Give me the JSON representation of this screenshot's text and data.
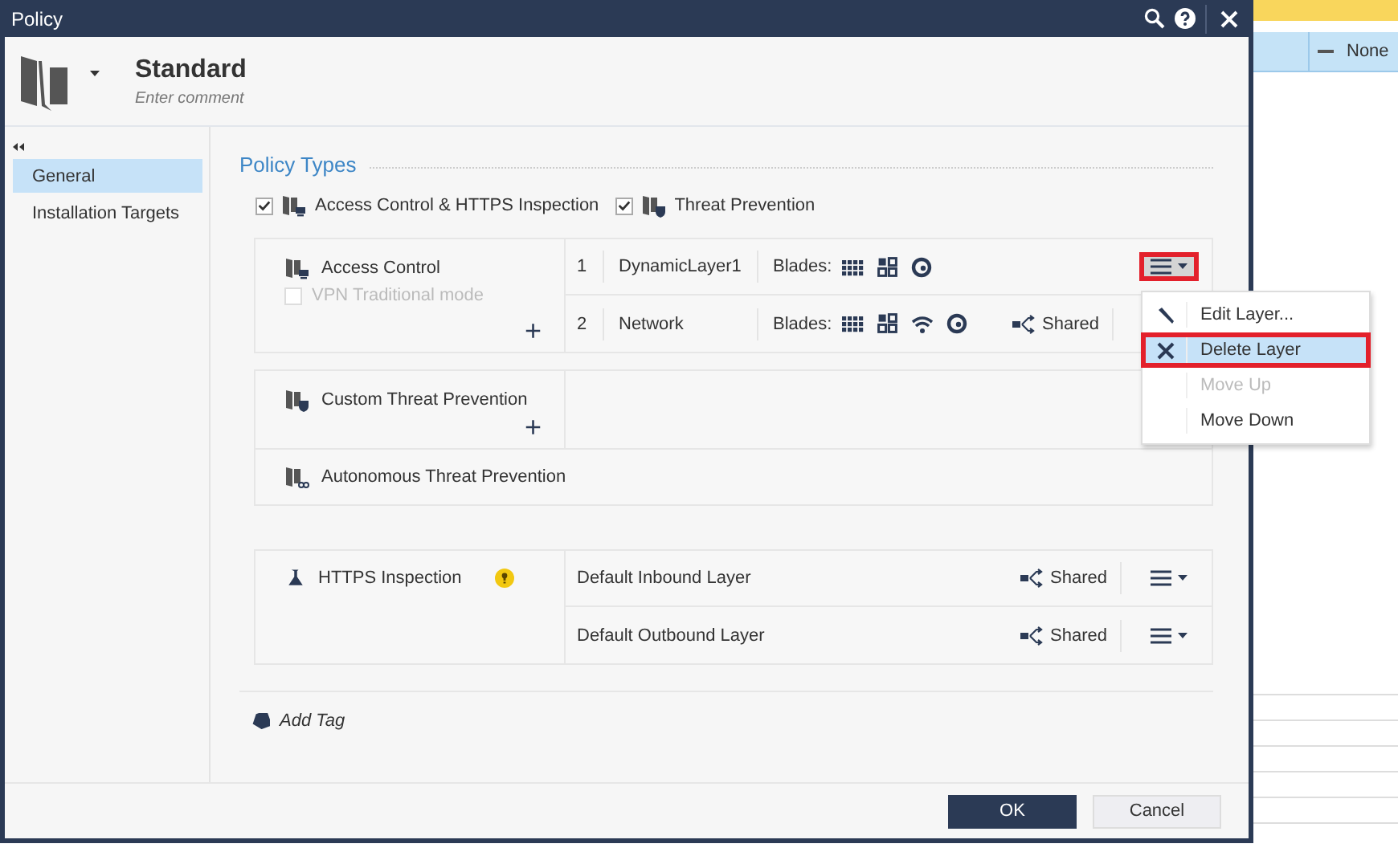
{
  "window": {
    "title": "Policy"
  },
  "header": {
    "name": "Standard",
    "comment": {
      "placeholder": "Enter comment"
    }
  },
  "sidebar": {
    "items": [
      {
        "label": "General",
        "selected": true
      },
      {
        "label": "Installation Targets",
        "selected": false
      }
    ]
  },
  "policy_types": {
    "title": "Policy Types",
    "options": [
      {
        "label": "Access Control & HTTPS Inspection",
        "checked": true
      },
      {
        "label": "Threat Prevention",
        "checked": true
      }
    ]
  },
  "groups": [
    {
      "sections": [
        {
          "kind": "split",
          "title": "Access Control",
          "option": {
            "label": "VPN Traditional mode",
            "checked": false,
            "disabled": true
          },
          "add": "+",
          "layers": [
            {
              "number": "1",
              "name": "DynamicLayer1",
              "blades_label": "Blades:",
              "blades": [
                {
                  "kind": "grid"
                },
                {
                  "kind": "tiles"
                },
                {
                  "kind": "target"
                }
              ],
              "menu": true,
              "highlighted": true
            },
            {
              "number": "2",
              "name": "Network",
              "blades_label": "Blades:",
              "blades": [
                {
                  "kind": "grid"
                },
                {
                  "kind": "tiles"
                },
                {
                  "kind": "wifi"
                },
                {
                  "kind": "target"
                }
              ],
              "shared": "Shared",
              "menu": false
            }
          ]
        }
      ]
    },
    {
      "sections": [
        {
          "kind": "split",
          "title": "Custom Threat Prevention",
          "add": "+"
        },
        {
          "kind": "full",
          "title": "Autonomous Threat Prevention"
        }
      ]
    },
    {
      "sections": [
        {
          "kind": "split",
          "title": "HTTPS Inspection",
          "tip": true,
          "layers": [
            {
              "name": "Default Inbound Layer",
              "shared": "Shared",
              "menu": true,
              "highlighted": false
            },
            {
              "name": "Default Outbound Layer",
              "shared": "Shared",
              "menu": true,
              "highlighted": false
            }
          ]
        }
      ]
    }
  ],
  "layer_menu": {
    "items": [
      {
        "label": "Edit Layer...",
        "disabled": false,
        "selected": false,
        "highlighted": false
      },
      {
        "label": "Delete Layer",
        "disabled": false,
        "selected": true,
        "highlighted": true
      },
      {
        "label": "Move Up",
        "disabled": true,
        "selected": false,
        "highlighted": false
      },
      {
        "label": "Move Down",
        "disabled": false,
        "selected": false,
        "highlighted": false
      }
    ]
  },
  "add_tag": "Add Tag",
  "buttons": [
    {
      "label": "OK",
      "kind": "primary"
    },
    {
      "label": "Cancel",
      "kind": "secondary"
    }
  ],
  "background": {
    "cell": "None"
  }
}
